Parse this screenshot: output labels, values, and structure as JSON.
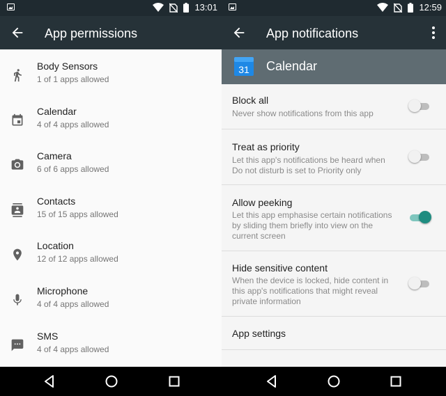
{
  "left_panel": {
    "status_time": "13:01",
    "title": "App permissions",
    "items": [
      {
        "label": "Body Sensors",
        "subtitle": "1 of 1 apps allowed",
        "icon": "body-sensors-icon"
      },
      {
        "label": "Calendar",
        "subtitle": "4 of 4 apps allowed",
        "icon": "calendar-icon"
      },
      {
        "label": "Camera",
        "subtitle": "6 of 6 apps allowed",
        "icon": "camera-icon"
      },
      {
        "label": "Contacts",
        "subtitle": "15 of 15 apps allowed",
        "icon": "contacts-icon"
      },
      {
        "label": "Location",
        "subtitle": "12 of 12 apps allowed",
        "icon": "location-icon"
      },
      {
        "label": "Microphone",
        "subtitle": "4 of 4 apps allowed",
        "icon": "microphone-icon"
      },
      {
        "label": "SMS",
        "subtitle": "4 of 4 apps allowed",
        "icon": "sms-icon"
      }
    ]
  },
  "right_panel": {
    "status_time": "12:59",
    "title": "App notifications",
    "app": {
      "name": "Calendar",
      "icon_day": "31"
    },
    "settings": [
      {
        "title": "Block all",
        "description": "Never show notifications from this app",
        "enabled": false
      },
      {
        "title": "Treat as priority",
        "description": "Let this app's notifications be heard when Do not disturb is set to Priority only",
        "enabled": false
      },
      {
        "title": "Allow peeking",
        "description": "Let this app emphasise certain notifications by sliding them briefly into view on the current screen",
        "enabled": true
      },
      {
        "title": "Hide sensitive content",
        "description": "When the device is locked, hide content in this app's notifications that might reveal private information",
        "enabled": false
      }
    ],
    "app_settings_label": "App settings"
  },
  "colors": {
    "status_bar": "#1f2a30",
    "app_bar": "#263238",
    "app_header": "#5f6c72",
    "toggle_on": "#1e8c80",
    "icon_gray": "#616161"
  }
}
